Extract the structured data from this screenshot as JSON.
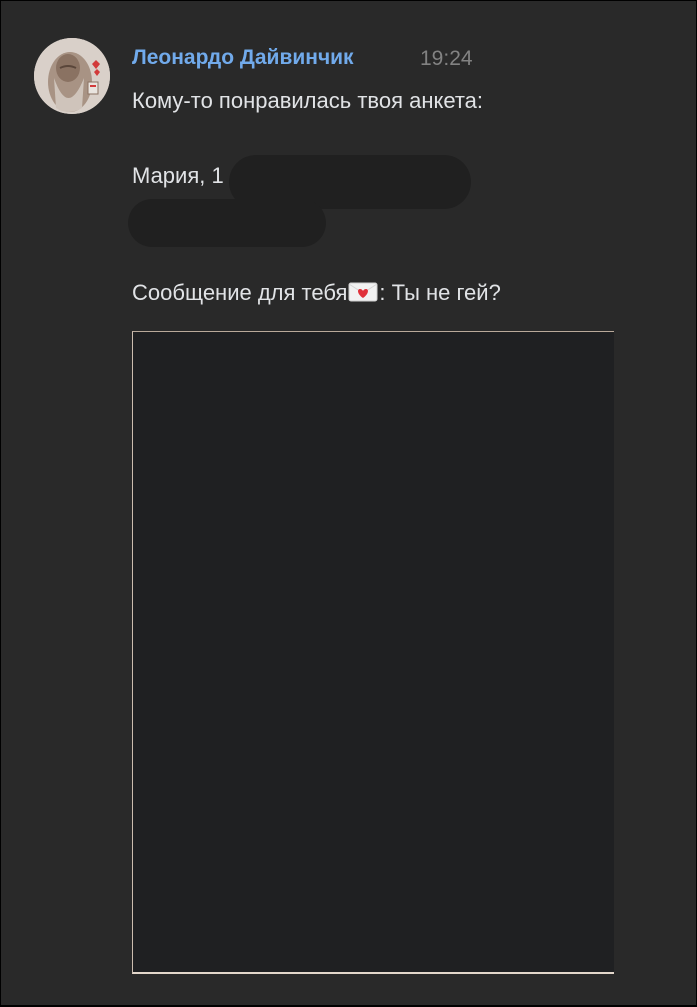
{
  "message": {
    "author": "Леонардо Дайвинчик",
    "time": "19:24",
    "line1": "Кому-то понравилась твоя анкета:",
    "line2": "Мария, 1",
    "line3_before": "Сообщение для тебя",
    "line3_after": ": Ты не гей?",
    "emoji": "love-letter-icon"
  },
  "colors": {
    "background": "#292929",
    "author": "#71aaeb",
    "text": "#e1e3e6",
    "time": "#828282"
  }
}
